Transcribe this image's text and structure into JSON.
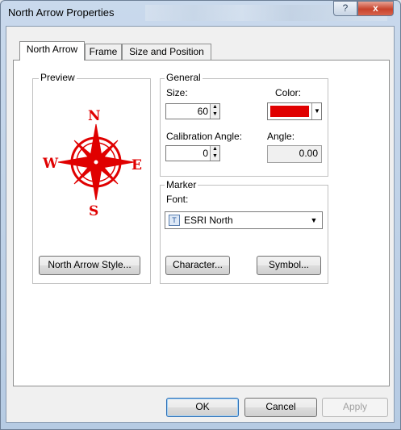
{
  "window": {
    "title": "North Arrow Properties",
    "help": "?",
    "close": "x"
  },
  "tabs": [
    "North Arrow",
    "Frame",
    "Size and Position"
  ],
  "preview": {
    "label": "Preview",
    "compass": {
      "n": "N",
      "s": "S",
      "e": "E",
      "w": "W"
    },
    "style_button": "North Arrow Style..."
  },
  "general": {
    "label": "General",
    "size_label": "Size:",
    "size_value": "60",
    "color_label": "Color:",
    "color_value": "#e00000",
    "calibration_label": "Calibration Angle:",
    "calibration_value": "0",
    "angle_label": "Angle:",
    "angle_value": "0.00"
  },
  "marker": {
    "label": "Marker",
    "font_label": "Font:",
    "font_value": "ESRI North",
    "character_button": "Character...",
    "symbol_button": "Symbol..."
  },
  "buttons": {
    "ok": "OK",
    "cancel": "Cancel",
    "apply": "Apply"
  }
}
